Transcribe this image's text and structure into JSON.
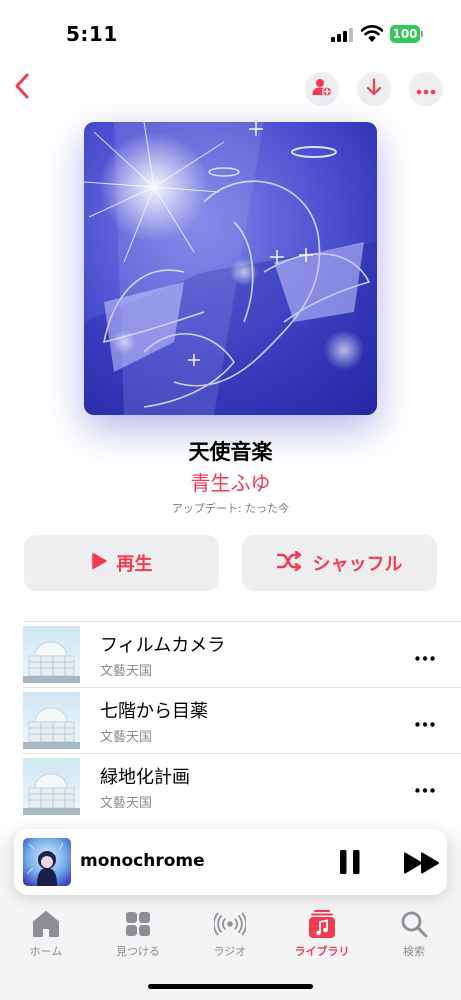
{
  "status_bar": {
    "time": "5:11",
    "battery_level": "100",
    "battery_color": "#34c759",
    "icons": [
      "signal-icon",
      "wifi-icon",
      "battery-icon"
    ]
  },
  "nav": {
    "back_icon": "chevron-left-icon",
    "actions": [
      "add-person-icon",
      "download-icon",
      "more-icon"
    ]
  },
  "playlist": {
    "title": "天使音楽",
    "curator": "青生ふゆ",
    "updated": "アップデート: たった今"
  },
  "actions": {
    "play_label": "再生",
    "shuffle_label": "シャッフル",
    "play_icon": "play-icon",
    "shuffle_icon": "shuffle-icon"
  },
  "tracks": [
    {
      "title": "フィルムカメラ",
      "artist": "文藝天国"
    },
    {
      "title": "七階から目薬",
      "artist": "文藝天国"
    },
    {
      "title": "緑地化計画",
      "artist": "文藝天国"
    }
  ],
  "mini_player": {
    "title": "monochrome",
    "pause_icon": "pause-icon",
    "next_icon": "forward-icon"
  },
  "tab_bar": {
    "tabs": [
      {
        "label": "ホーム",
        "icon": "home-icon"
      },
      {
        "label": "見つける",
        "icon": "grid-icon"
      },
      {
        "label": "ラジオ",
        "icon": "radio-icon"
      },
      {
        "label": "ライブラリ",
        "icon": "library-icon",
        "active": true
      },
      {
        "label": "検索",
        "icon": "search-icon"
      }
    ]
  },
  "colors": {
    "accent": "#f23a50",
    "button_bg": "#eeeef0",
    "secondary_text": "#8a8a8a"
  }
}
